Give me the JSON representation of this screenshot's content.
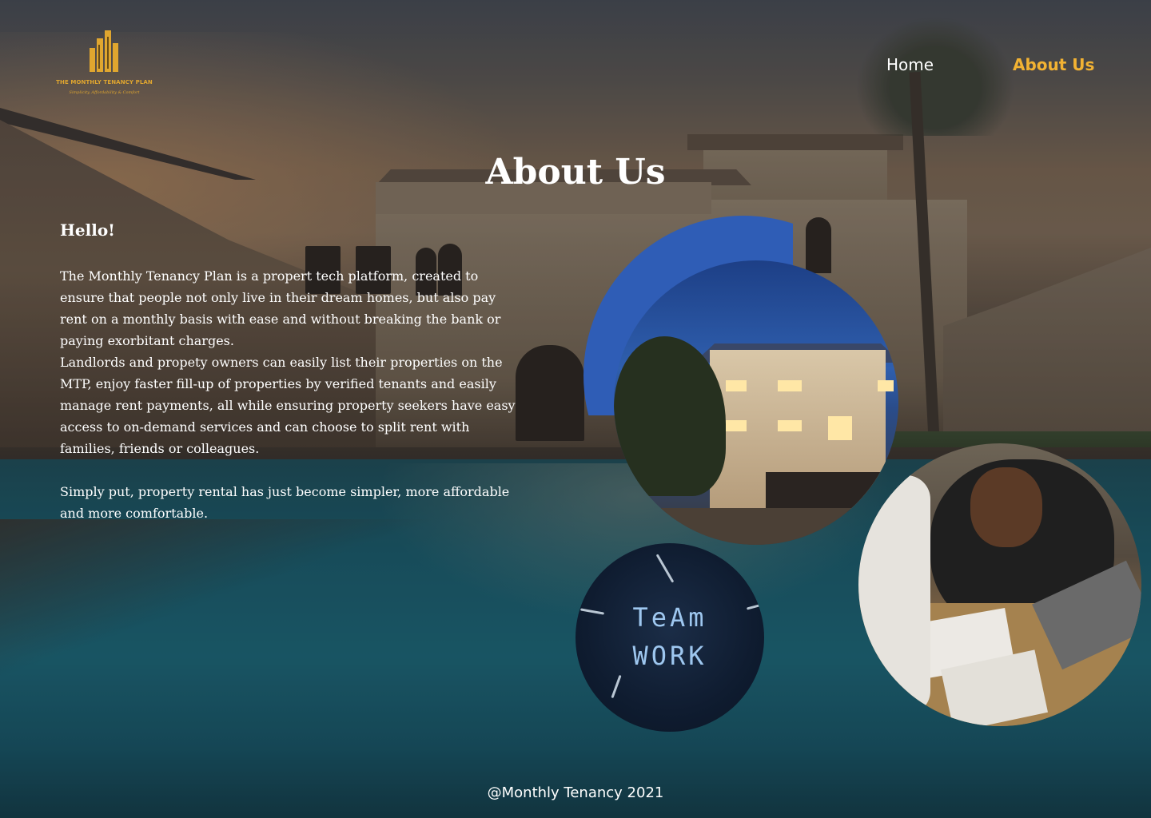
{
  "brand": {
    "name": "THE MONTHLY TENANCY PLAN",
    "tagline": "Simplicity, Affordability & Comfort",
    "accent_color": "#f2b233"
  },
  "nav": {
    "items": [
      {
        "label": "Home",
        "active": false
      },
      {
        "label": "About Us",
        "active": true
      }
    ]
  },
  "main": {
    "title": "About Us",
    "greeting": "Hello!",
    "paragraphs": [
      "The Monthly Tenancy Plan is a propert tech platform, created to ensure that people not only live in their dream homes, but also pay rent on a monthly basis with ease and without breaking the bank or paying exorbitant charges.",
      "Landlords and propety owners can easily list their properties on the MTP, enjoy faster fill-up of properties by verified tenants and easily manage rent payments, all while ensuring property seekers have easy access to on-demand services and can choose to split rent with families, friends or colleagues.",
      "Simply put, property rental has just become simpler, more affordable and more comfortable."
    ]
  },
  "images": {
    "teamwork": {
      "line1": "TeAm",
      "line2": "WORK"
    }
  },
  "footer": {
    "text": "@Monthly Tenancy 2021"
  }
}
